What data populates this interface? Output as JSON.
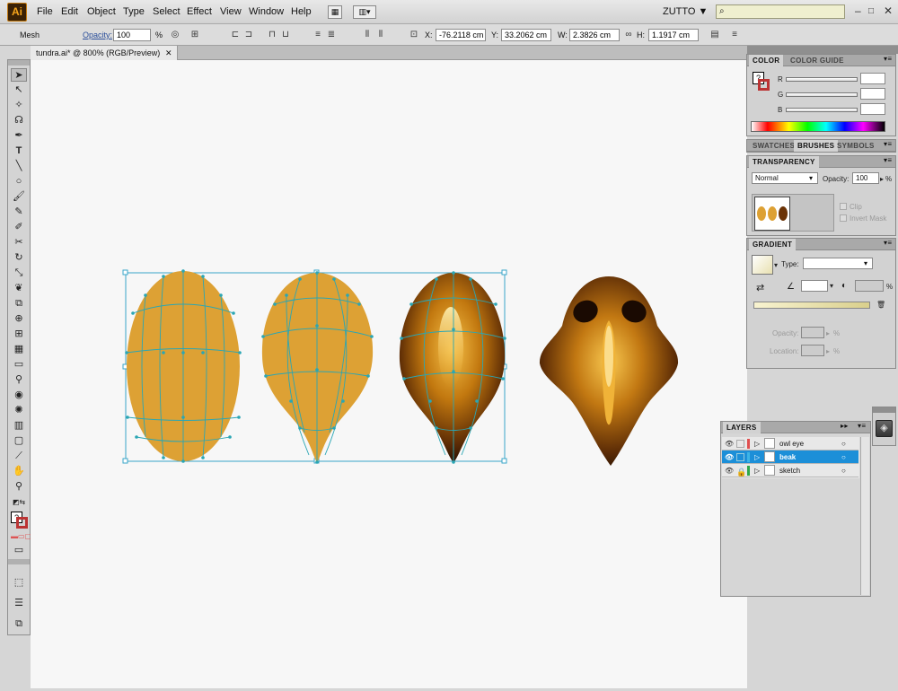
{
  "app": {
    "logo": "Ai",
    "workspace": "ZUTTO",
    "workspace_arrow": "▼",
    "search_icon": "⌕",
    "window_controls": [
      "–",
      "□",
      "✕"
    ]
  },
  "menus": [
    "File",
    "Edit",
    "Object",
    "Type",
    "Select",
    "Effect",
    "View",
    "Window",
    "Help"
  ],
  "control_bar": {
    "tool_name": "Mesh",
    "opacity_label": "Opacity:",
    "opacity_value": "100",
    "percent": "%",
    "x_label": "X:",
    "x_value": "-76.2118 cm",
    "y_label": "Y:",
    "y_value": "33.2062 cm",
    "w_label": "W:",
    "w_value": "2.3826 cm",
    "h_label": "H:",
    "h_value": "1.1917 cm"
  },
  "document": {
    "tab_title": "tundra.ai* @ 800% (RGB/Preview)",
    "close": "✕"
  },
  "color_panel": {
    "tabs": [
      "COLOR",
      "COLOR GUIDE"
    ],
    "channels": [
      "R",
      "G",
      "B"
    ],
    "fill_icon": "?"
  },
  "swatch_tabs": [
    "SWATCHES",
    "BRUSHES",
    "SYMBOLS"
  ],
  "transparency": {
    "title": "TRANSPARENCY",
    "mode": "Normal",
    "opacity_label": "Opacity:",
    "opacity_value": "100",
    "percent": "%",
    "clip": "Clip",
    "invert_mask": "Invert Mask"
  },
  "gradient": {
    "title": "GRADIENT",
    "type_label": "Type:",
    "percent": "%",
    "opacity_label": "Opacity:",
    "location_label": "Location:",
    "percent_small": "%"
  },
  "layers": {
    "title": "LAYERS",
    "rows": [
      {
        "name": "owl eye",
        "color": "#e05050",
        "selected": false
      },
      {
        "name": "beak",
        "color": "#3cb4e6",
        "selected": true
      },
      {
        "name": "sketch",
        "color": "#2ea84a",
        "selected": false
      }
    ]
  },
  "colors": {
    "accent": "#1c8fd8",
    "shape_fill": "#dda134",
    "mesh_line": "#2aa6b4",
    "bbox": "#3aa6c9"
  }
}
